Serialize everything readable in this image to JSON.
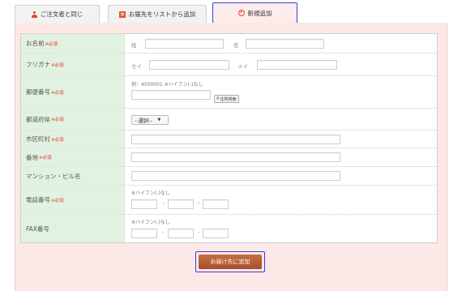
{
  "tabs": [
    {
      "label": "ご注文者と同じ",
      "icon": "person-icon"
    },
    {
      "label": "お届先をリストから追加",
      "icon": "list-icon"
    },
    {
      "label": "新規追加",
      "icon": "plus-circle-icon"
    }
  ],
  "required_mark": "※必須",
  "form": {
    "name": {
      "label": "お名前",
      "last": "姓",
      "first": "名"
    },
    "kana": {
      "label": "フリガナ",
      "last": "セイ",
      "first": "メイ"
    },
    "postal": {
      "label": "郵便番号",
      "example": "例：4500001 ※ハイフン(-)なし",
      "search_button": "住所検索"
    },
    "prefecture": {
      "label": "都道府県",
      "select_value": "--選択--"
    },
    "city": {
      "label": "市区町村"
    },
    "address": {
      "label": "番地"
    },
    "building": {
      "label": "マンション・ビル名"
    },
    "phone": {
      "label": "電話番号",
      "hint": "※ハイフン(-)なし"
    },
    "fax": {
      "label": "FAX番号",
      "hint": "※ハイフン(-)なし"
    },
    "separator": "-"
  },
  "submit_label": "お届け先に追加",
  "colors": {
    "label_bg": "#e2f2e2",
    "panel_bg": "#fde8e8",
    "required": "#e0382a",
    "button": "#b35d35",
    "focus_border": "#3c3cd6"
  }
}
